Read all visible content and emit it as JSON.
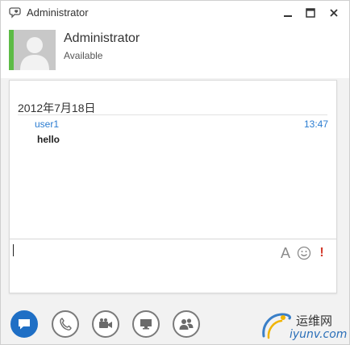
{
  "window": {
    "title": "Administrator",
    "icon": "lync-chat-icon",
    "controls": [
      "minimize-icon",
      "maximize-icon",
      "close-icon"
    ]
  },
  "contact": {
    "name": "Administrator",
    "status": "Available",
    "presence_color": "#5dbb46",
    "avatar": "default-avatar-icon"
  },
  "conversation": {
    "date": "2012年7月18日",
    "messages": [
      {
        "sender": "user1",
        "time": "13:47",
        "text": "hello"
      }
    ]
  },
  "compose": {
    "value": "",
    "placeholder": "",
    "tools": {
      "font_label": "A",
      "emoticon_icon": "smiley-icon",
      "important_label": "!"
    }
  },
  "modes": [
    {
      "name": "im",
      "icon": "chat-bubble-icon",
      "active": true
    },
    {
      "name": "call",
      "icon": "phone-icon",
      "active": false
    },
    {
      "name": "video",
      "icon": "video-camera-icon",
      "active": false
    },
    {
      "name": "present",
      "icon": "monitor-icon",
      "active": false
    },
    {
      "name": "participants",
      "icon": "people-icon",
      "active": false
    }
  ],
  "watermark": {
    "cn": "运维网",
    "en": "iyunv.com"
  },
  "colors": {
    "accent": "#1f6fc5",
    "link": "#2a7cd1",
    "important": "#d33a2c"
  }
}
